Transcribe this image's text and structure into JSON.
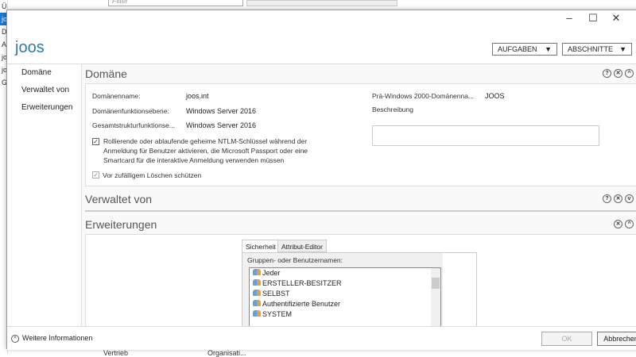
{
  "background": {
    "left_items": [
      "Ü",
      "jo",
      "D",
      "A",
      "jo",
      "jo",
      "G"
    ],
    "filter_placeholder": "Filter",
    "bottom_row": [
      "Vertrieb",
      "Organisati..."
    ]
  },
  "window": {
    "minimize": "–",
    "maximize": "☐",
    "close": "✕"
  },
  "header": {
    "title": "joos",
    "tasks": "AUFGABEN",
    "sections": "ABSCHNITTE"
  },
  "nav": [
    "Domäne",
    "Verwaltet von",
    "Erweiterungen"
  ],
  "domain": {
    "title": "Domäne",
    "name_label": "Domänenname:",
    "name_value": "joos.int",
    "dfl_label": "Domänenfunktionsebene:",
    "dfl_value": "Windows Server 2016",
    "ffl_label": "Gesamtstrukturfunktionse...",
    "ffl_value": "Windows Server 2016",
    "pre2000_label": "Prä-Windows 2000-Domänenna...",
    "pre2000_value": "JOOS",
    "description_label": "Beschreibung",
    "description_value": "",
    "ntlm_checkbox": "Rollierende oder ablaufende geheime NTLM-Schlüssel während der Anmeldung für Benutzer aktivieren, die Microsoft Passport oder eine Smartcard für die interaktive Anmeldung verwenden müssen",
    "protect_checkbox": "Vor zufälligem Löschen schützen"
  },
  "managed_by": {
    "title": "Verwaltet von"
  },
  "extensions": {
    "title": "Erweiterungen",
    "tabs": [
      "Sicherheit",
      "Attribut-Editor"
    ],
    "groups_label": "Gruppen- oder Benutzernamen:",
    "users": [
      "Jeder",
      "ERSTELLER-BESITZER",
      "SELBST",
      "Authentifizierte Benutzer",
      "SYSTEM"
    ]
  },
  "footer": {
    "more_info": "Weitere Informationen",
    "ok": "OK",
    "cancel": "Abbrechen"
  }
}
